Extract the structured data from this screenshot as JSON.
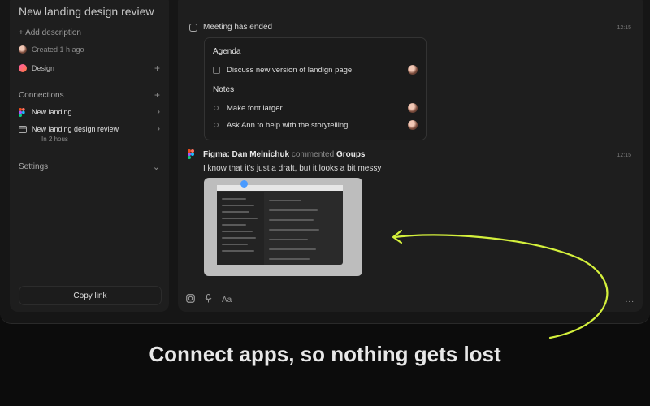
{
  "sidebar": {
    "title": "New landing design review",
    "add_description": "+ Add description",
    "created": "Created 1 h ago",
    "tag": "Design",
    "connections": {
      "label": "Connections",
      "items": [
        {
          "label": "New landing"
        },
        {
          "label": "New landing design review",
          "sub": "In 2 hous"
        }
      ]
    },
    "settings_label": "Settings",
    "copy_link": "Copy link"
  },
  "feed": {
    "meeting": {
      "title": "Meeting has ended",
      "time": "12:15",
      "agenda_label": "Agenda",
      "agenda_items": [
        "Discuss new version of landign page"
      ],
      "notes_label": "Notes",
      "notes_items": [
        "Make font larger",
        "Ask Ann to help with the storytelling"
      ]
    },
    "comment": {
      "source": "Figma: Dan Melnichuk",
      "verb": "commented",
      "target": "Groups",
      "time": "12:15",
      "text": "I know that it’s just a draft, but it looks a bit messy"
    }
  },
  "composer": {
    "font_label": "Aa",
    "more": "..."
  },
  "headline": "Connect apps, so nothing gets lost",
  "colors": {
    "accent_arrow": "#d4f03c",
    "figma_pink": "#ff5ba8"
  }
}
